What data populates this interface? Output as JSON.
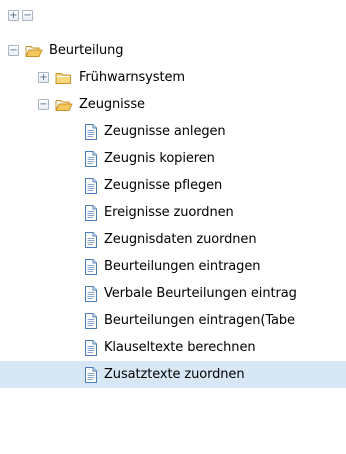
{
  "toolbar": {
    "expand_all": "+",
    "collapse_all": "−"
  },
  "tree": {
    "root": {
      "label": "Beurteilung",
      "toggle": "−",
      "icon": "folder-open-icon"
    },
    "fruehwarnsystem": {
      "label": "Frühwarnsystem",
      "toggle": "+",
      "icon": "folder-closed-icon"
    },
    "zeugnisse": {
      "label": "Zeugnisse",
      "toggle": "−",
      "icon": "folder-open-icon"
    },
    "items": [
      {
        "label": "Zeugnisse anlegen",
        "icon": "document-icon"
      },
      {
        "label": "Zeugnis kopieren",
        "icon": "document-icon"
      },
      {
        "label": "Zeugnisse pflegen",
        "icon": "document-icon"
      },
      {
        "label": "Ereignisse zuordnen",
        "icon": "document-icon"
      },
      {
        "label": "Zeugnisdaten zuordnen",
        "icon": "document-icon"
      },
      {
        "label": "Beurteilungen eintragen",
        "icon": "document-icon"
      },
      {
        "label": "Verbale Beurteilungen eintrag",
        "icon": "document-icon"
      },
      {
        "label": "Beurteilungen eintragen(Tabe",
        "icon": "document-icon"
      },
      {
        "label": "Klauseltexte berechnen",
        "icon": "document-icon"
      },
      {
        "label": "Zusatztexte zuordnen",
        "icon": "document-icon",
        "selected": true
      }
    ]
  },
  "colors": {
    "selection": "#d8e7f6",
    "folder": "#f3c75a",
    "folder_outline": "#c8922c",
    "document_outline": "#4b7cb5"
  }
}
